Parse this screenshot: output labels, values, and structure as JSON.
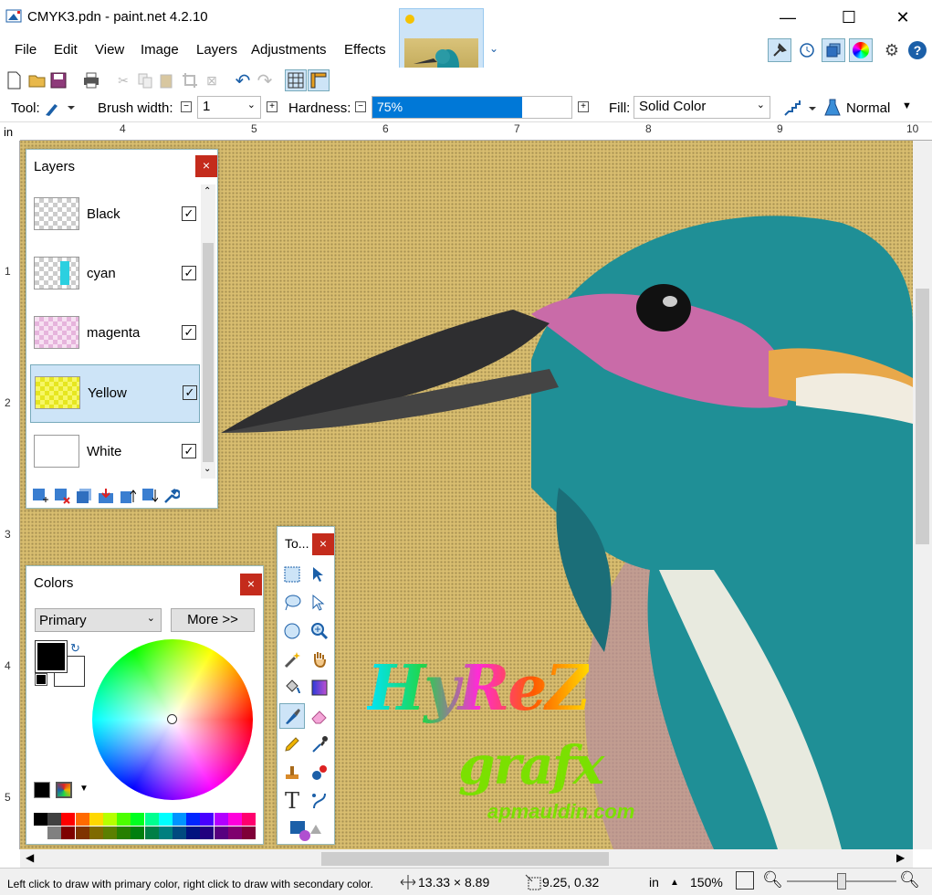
{
  "window": {
    "title": "CMYK3.pdn - paint.net 4.2.10",
    "min": "—",
    "max": "☐",
    "close": "✕"
  },
  "menu": [
    "File",
    "Edit",
    "View",
    "Image",
    "Layers",
    "Adjustments",
    "Effects"
  ],
  "toolbar": {
    "tool_label": "Tool:",
    "brush_label": "Brush width:",
    "brush_value": "1",
    "hardness_label": "Hardness:",
    "hardness_value": "75%",
    "hardness_fraction": 0.75,
    "fill_label": "Fill:",
    "fill_value": "Solid Color",
    "blend_value": "Normal"
  },
  "ruler": {
    "unit": "in",
    "h_ticks": [
      "4",
      "5",
      "6",
      "7",
      "8",
      "9",
      "10"
    ],
    "v_ticks": [
      "1",
      "2",
      "3",
      "4",
      "5"
    ]
  },
  "layers_panel": {
    "title": "Layers",
    "close": "×",
    "layers": [
      {
        "name": "Black",
        "visible": true,
        "selected": false
      },
      {
        "name": "cyan",
        "visible": true,
        "selected": false
      },
      {
        "name": "magenta",
        "visible": true,
        "selected": false
      },
      {
        "name": "Yellow",
        "visible": true,
        "selected": true
      },
      {
        "name": "White",
        "visible": true,
        "selected": false
      }
    ]
  },
  "tools_panel": {
    "title": "To...",
    "close": "×"
  },
  "colors_panel": {
    "title": "Colors",
    "close": "×",
    "mode": "Primary",
    "more_button": "More >>",
    "primary_color": "#000000",
    "secondary_color": "#ffffff",
    "palette_row1": [
      "#000000",
      "#404040",
      "#ff0000",
      "#ff6a00",
      "#ffd800",
      "#b6ff00",
      "#4cff00",
      "#00ff21",
      "#00ff90",
      "#00ffff",
      "#0094ff",
      "#0026ff",
      "#4800ff",
      "#b200ff",
      "#ff00dc",
      "#ff006e"
    ],
    "palette_row2": [
      "#ffffff",
      "#808080",
      "#7f0000",
      "#7f3300",
      "#7f6a00",
      "#5b7f00",
      "#267f00",
      "#007f0e",
      "#007f46",
      "#007f7f",
      "#004a7f",
      "#00137f",
      "#21007f",
      "#57007f",
      "#7f006e",
      "#7f0037"
    ]
  },
  "canvas": {
    "logo_line1": "HyReZ",
    "logo_line2": "grafx",
    "logo_line3": "apmauldin.com"
  },
  "status": {
    "hint": "Left click to draw with primary color, right click to draw with secondary color.",
    "size": "13.33 × 8.89",
    "position": "9.25, 0.32",
    "unit": "in",
    "zoom": "150%"
  }
}
